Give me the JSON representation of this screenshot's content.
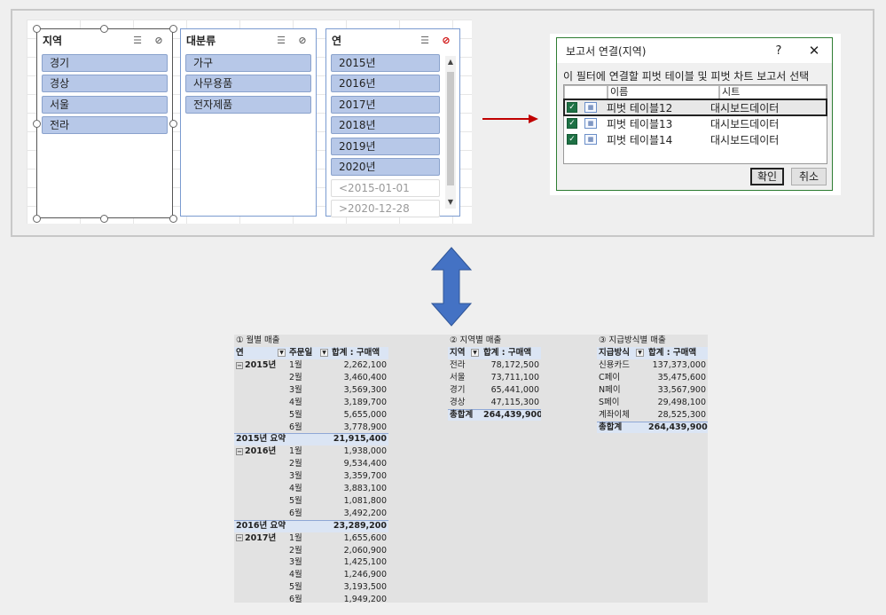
{
  "slicers": [
    {
      "title": "지역",
      "items": [
        "경기",
        "경상",
        "서울",
        "전라"
      ]
    },
    {
      "title": "대분류",
      "items": [
        "가구",
        "사무용품",
        "전자제품"
      ]
    },
    {
      "title": "연",
      "items": [
        "2015년",
        "2016년",
        "2017년",
        "2018년",
        "2019년",
        "2020년"
      ],
      "nodata_items": [
        "<2015-01-01",
        ">2020-12-28"
      ]
    }
  ],
  "dialog": {
    "title": "보고서 연결(지역)",
    "help": "?",
    "close": "✕",
    "description": "이 필터에 연결할 피벗 테이블 및 피벗 차트 보고서 선택",
    "col_name": "이름",
    "col_sheet": "시트",
    "rows": [
      {
        "name": "피벗 테이블12",
        "sheet": "대시보드데이터"
      },
      {
        "name": "피벗 테이블13",
        "sheet": "대시보드데이터"
      },
      {
        "name": "피벗 테이블14",
        "sheet": "대시보드데이터"
      }
    ],
    "ok": "확인",
    "cancel": "취소"
  },
  "pivot1": {
    "title": "① 월별 매출",
    "h_year": "연",
    "h_month": "주문일",
    "h_sum": "합계 : 구매액",
    "groups": [
      {
        "year": "2015년",
        "rows": [
          [
            "1월",
            "2,262,100"
          ],
          [
            "2월",
            "3,460,400"
          ],
          [
            "3월",
            "3,569,300"
          ],
          [
            "4월",
            "3,189,700"
          ],
          [
            "5월",
            "5,655,000"
          ],
          [
            "6월",
            "3,778,900"
          ]
        ],
        "subtotal_label": "2015년 요약",
        "subtotal": "21,915,400"
      },
      {
        "year": "2016년",
        "rows": [
          [
            "1월",
            "1,938,000"
          ],
          [
            "2월",
            "9,534,400"
          ],
          [
            "3월",
            "3,359,700"
          ],
          [
            "4월",
            "3,883,100"
          ],
          [
            "5월",
            "1,081,800"
          ],
          [
            "6월",
            "3,492,200"
          ]
        ],
        "subtotal_label": "2016년 요약",
        "subtotal": "23,289,200"
      },
      {
        "year": "2017년",
        "rows": [
          [
            "1월",
            "1,655,600"
          ],
          [
            "2월",
            "2,060,900"
          ],
          [
            "3월",
            "1,425,100"
          ],
          [
            "4월",
            "1,246,900"
          ],
          [
            "5월",
            "3,193,500"
          ],
          [
            "6월",
            "1,949,200"
          ]
        ]
      }
    ]
  },
  "pivot2": {
    "title": "② 지역별 매출",
    "h_region": "지역",
    "h_sum": "합계 : 구매액",
    "rows": [
      [
        "전라",
        "78,172,500"
      ],
      [
        "서울",
        "73,711,100"
      ],
      [
        "경기",
        "65,441,000"
      ],
      [
        "경상",
        "47,115,300"
      ]
    ],
    "total_label": "총합계",
    "total": "264,439,900"
  },
  "pivot3": {
    "title": "③ 지급방식별 매출",
    "h_method": "지급방식",
    "h_sum": "합계 : 구매액",
    "rows": [
      [
        "신용카드",
        "137,373,000"
      ],
      [
        "C페이",
        "35,475,600"
      ],
      [
        "N페이",
        "33,567,900"
      ],
      [
        "S페이",
        "29,498,100"
      ],
      [
        "계좌이체",
        "28,525,300"
      ]
    ],
    "total_label": "총합계",
    "total": "264,439,900"
  },
  "colors": {
    "slicer_item": "#b7c8e8",
    "accent_red": "#c00000",
    "arrow_blue": "#4472c4",
    "check_green": "#1e7145"
  }
}
